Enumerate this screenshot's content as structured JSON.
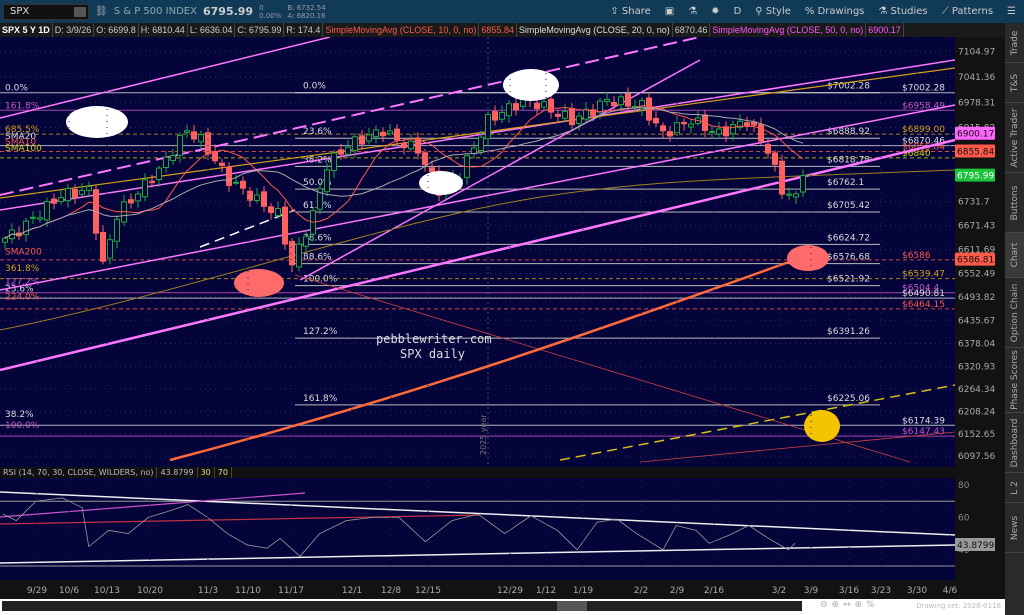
{
  "toolbar": {
    "symbol": "SPX",
    "name": "S & P 500 INDEX",
    "last": "6795.99",
    "change": "0",
    "change_pct": "0.00%",
    "bid": "B: 6732.54",
    "ask": "A: 6820.16",
    "share": "Share",
    "period": "D",
    "style": "Style",
    "drawings": "Drawings",
    "studies": "Studies",
    "patterns": "Patterns"
  },
  "info": {
    "title": "SPX 5 Y 1D",
    "date": "D: 3/9/26",
    "open": "O: 6699.8",
    "high": "H: 6810.44",
    "low": "L: 6636.04",
    "close": "C: 6795.99",
    "range": "R: 174.4",
    "sma10": "SimpleMovingAvg (CLOSE, 10, 0, no)",
    "sma10_val": "6855.84",
    "sma20": "SimpleMovingAvg (CLOSE, 20, 0, no)",
    "sma20_val": "6870.46",
    "sma50": "SimpleMovingAvg (CLOSE, 50, 0, no)",
    "sma50_val": "6900.17"
  },
  "side_tabs": [
    "Trade",
    "T&S",
    "Active Trader",
    "Buttons",
    "Chart",
    "Option Chain",
    "Phase Scores",
    "Dashboard",
    "L 2",
    "News"
  ],
  "colors": {
    "bg": "#04043a",
    "up": "#1faa3a",
    "down": "#ff6060",
    "magenta": "#ff77ff",
    "gold": "#d4a017"
  },
  "price_axis": [
    "7104.97",
    "7041.36",
    "6978.31",
    "6915.82",
    "6731.7",
    "6671.43",
    "6611.69",
    "6552.49",
    "6493.82",
    "6435.67",
    "6378.04",
    "6320.93",
    "6264.34",
    "6208.24",
    "6152.65",
    "6097.56"
  ],
  "price_badges": [
    {
      "v": "6900.17",
      "c": "#ff66ff"
    },
    {
      "v": "6855.84",
      "c": "#ff5a4a"
    },
    {
      "v": "6795.99",
      "c": "#19c43a"
    },
    {
      "v": "6586.81",
      "c": "#ff5a4a"
    }
  ],
  "fib_mid": [
    {
      "p": "0.0%",
      "v": 7002.28,
      "t": "$7002.28"
    },
    {
      "p": "23.6%",
      "v": 6888.92,
      "t": "$6888.92"
    },
    {
      "p": "38.2%",
      "v": 6818.78,
      "t": "$6818.78"
    },
    {
      "p": "50.0%",
      "v": 6762.1,
      "t": "$6762.1"
    },
    {
      "p": "61.8%",
      "v": 6705.42,
      "t": "$6705.42"
    },
    {
      "p": "78.6%",
      "v": 6624.72,
      "t": "$6624.72"
    },
    {
      "p": "88.6%",
      "v": 6576.68,
      "t": "$6576.68"
    },
    {
      "p": "100.0%",
      "v": 6521.92,
      "t": "$6521.92"
    },
    {
      "p": "127.2%",
      "v": 6391.26,
      "t": "$6391.26"
    },
    {
      "p": "161.8%",
      "v": 6225.06,
      "t": "$6225.06"
    }
  ],
  "right_levels": [
    {
      "v": 7002.28,
      "t": "$7002.28",
      "c": "#dddddd"
    },
    {
      "v": 6958.49,
      "t": "$6958.49",
      "c": "#cc55cc"
    },
    {
      "v": 6899.0,
      "t": "$6899.00",
      "c": "#d4a017"
    },
    {
      "v": 6870.46,
      "t": "$6870.46",
      "c": "#dddddd"
    },
    {
      "v": 6855.84,
      "t": "$6855.84",
      "c": "#ff5a4a"
    },
    {
      "v": 6840,
      "t": "$6840",
      "c": "#d4d400"
    },
    {
      "v": 6586,
      "t": "$6586",
      "c": "#ff5a4a"
    },
    {
      "v": 6539.47,
      "t": "$6539.47",
      "c": "#d4a017"
    },
    {
      "v": 6504.4,
      "t": "$6504.4",
      "c": "#cc55cc"
    },
    {
      "v": 6490.81,
      "t": "$6490.81",
      "c": "#dddddd"
    },
    {
      "v": 6464.15,
      "t": "$6464.15",
      "c": "#ff5a4a"
    },
    {
      "v": 6174.39,
      "t": "$6174.39",
      "c": "#dddddd"
    },
    {
      "v": 6147.43,
      "t": "$6147.43",
      "c": "#cc55cc"
    }
  ],
  "left_labels": [
    {
      "v": 7002.28,
      "t": "0.0%",
      "c": "#dddddd"
    },
    {
      "v": 6958.49,
      "t": "161.8%",
      "c": "#cc55cc"
    },
    {
      "v": 6899,
      "t": "685.5%",
      "c": "#d4a017"
    },
    {
      "v": 6882,
      "t": "SMA20",
      "c": "#dddddd"
    },
    {
      "v": 6868,
      "t": "SMA10",
      "c": "#ff5a4a"
    },
    {
      "v": 6852,
      "t": "SMA100",
      "c": "#d4d400"
    },
    {
      "v": 6594,
      "t": "SMA200",
      "c": "#ff5a4a"
    },
    {
      "v": 6554,
      "t": "361.8%",
      "c": "#d4a017"
    },
    {
      "v": 6520,
      "t": "127.2%",
      "c": "#cc55cc"
    },
    {
      "v": 6503,
      "t": "23.6%",
      "c": "#dddddd"
    },
    {
      "v": 6482,
      "t": "224.0%",
      "c": "#ff5a4a"
    },
    {
      "v": 6190,
      "t": "38.2%",
      "c": "#dddddd"
    },
    {
      "v": 6162,
      "t": "100.0%",
      "c": "#cc55cc"
    }
  ],
  "annotation": {
    "line1": "pebblewriter.com",
    "line2": "SPX daily",
    "year": "2025 year"
  },
  "price_anchors": [
    [
      0,
      6640
    ],
    [
      2,
      6660
    ],
    [
      8,
      6747
    ],
    [
      12,
      6760
    ],
    [
      14,
      6573
    ],
    [
      16,
      6698
    ],
    [
      22,
      6810
    ],
    [
      26,
      6909
    ],
    [
      28,
      6884
    ],
    [
      32,
      6785
    ],
    [
      36,
      6735
    ],
    [
      39,
      6700
    ],
    [
      41,
      6573
    ],
    [
      44,
      6700
    ],
    [
      46,
      6822
    ],
    [
      49,
      6872
    ],
    [
      54,
      6909
    ],
    [
      56,
      6884
    ],
    [
      59,
      6860
    ],
    [
      62,
      6760
    ],
    [
      65,
      6800
    ],
    [
      69,
      6934
    ],
    [
      74,
      6984
    ],
    [
      76,
      6975
    ],
    [
      81,
      6934
    ],
    [
      84,
      6960
    ],
    [
      86,
      6984
    ],
    [
      91,
      6970
    ],
    [
      94,
      6900
    ],
    [
      98,
      6934
    ],
    [
      102,
      6900
    ],
    [
      106,
      6934
    ],
    [
      109,
      6860
    ],
    [
      111,
      6760
    ],
    [
      113,
      6740
    ],
    [
      114,
      6795.99
    ]
  ],
  "rsi": {
    "header": "RSI (14, 70, 30, CLOSE, WILDERS, no)",
    "value": "43.8799",
    "ob": "30",
    "os": "70",
    "axis": [
      "80",
      "60",
      "40"
    ],
    "anchors": [
      [
        0,
        62
      ],
      [
        2,
        58
      ],
      [
        5,
        70
      ],
      [
        9,
        72
      ],
      [
        12,
        66
      ],
      [
        13,
        42
      ],
      [
        16,
        52
      ],
      [
        19,
        50
      ],
      [
        22,
        60
      ],
      [
        26,
        65
      ],
      [
        28,
        68
      ],
      [
        31,
        60
      ],
      [
        34,
        50
      ],
      [
        37,
        43
      ],
      [
        40,
        41
      ],
      [
        42,
        47
      ],
      [
        45,
        36
      ],
      [
        48,
        50
      ],
      [
        52,
        58
      ],
      [
        56,
        60
      ],
      [
        60,
        60
      ],
      [
        64,
        45
      ],
      [
        68,
        58
      ],
      [
        72,
        62
      ],
      [
        76,
        50
      ],
      [
        80,
        61
      ],
      [
        84,
        52
      ],
      [
        87,
        40
      ],
      [
        90,
        57
      ],
      [
        93,
        59
      ],
      [
        96,
        50
      ],
      [
        100,
        40
      ],
      [
        102,
        55
      ],
      [
        105,
        52
      ],
      [
        107,
        44
      ],
      [
        110,
        49
      ],
      [
        113,
        55
      ],
      [
        116,
        47
      ],
      [
        119,
        40
      ],
      [
        120,
        44
      ]
    ]
  },
  "dates": [
    "9/29",
    "10/6",
    "10/13",
    "10/20",
    "11/3",
    "11/10",
    "11/17",
    "12/1",
    "12/8",
    "12/15",
    "12/29",
    "1/12",
    "1/19",
    "2/2",
    "2/9",
    "2/16",
    "3/2",
    "3/9",
    "3/16",
    "3/23",
    "3/30",
    "4/6"
  ],
  "drawing_set": "Drawing set: 2026-0116"
}
